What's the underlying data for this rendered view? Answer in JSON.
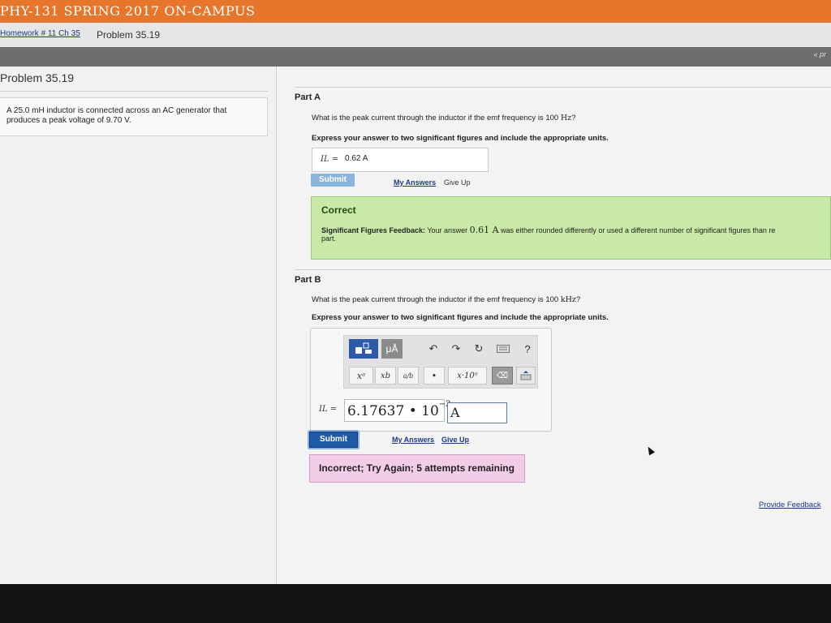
{
  "header": {
    "course_title": "PHY-131 SPRING 2017 ON-CAMPUS"
  },
  "breadcrumb": {
    "link": "Homework # 11 Ch 35",
    "current": "Problem 35.19"
  },
  "nav": {
    "prev": "« pr"
  },
  "problem": {
    "title": "Problem 35.19",
    "statement_line1": "A 25.0 mH inductor is connected across an AC generator that",
    "statement_line2": "produces a peak voltage of 9.70 V."
  },
  "part_a": {
    "title": "Part A",
    "question_text": "What is the peak current through the inductor if the emf frequency is 100 ",
    "question_unit": "Hz",
    "question_end": "?",
    "instruction": "Express your answer to two significant figures and include the appropriate units.",
    "answer_label": "IL =",
    "answer_value": "0.62 A",
    "submit_label": "Submit",
    "my_answers": "My Answers",
    "give_up": "Give Up",
    "feedback_title": "Correct",
    "feedback_bold": "Significant Figures Feedback:",
    "feedback_pre": " Your answer ",
    "feedback_value": "0.61 A",
    "feedback_post": " was either rounded differently or used a different number of significant figures than re",
    "feedback_line2": "part."
  },
  "part_b": {
    "title": "Part B",
    "question_text": "What is the peak current through the inductor if the emf frequency is 100 ",
    "question_unit": "kHz",
    "question_end": "?",
    "instruction": "Express your answer to two significant figures and include the appropriate units.",
    "toolbar": {
      "units_label": "μÅ",
      "superscript": "xᵃ",
      "subscript": "xb",
      "fraction": "a/b",
      "dot": "•",
      "sci_notation": "x·10ⁿ",
      "help": "?"
    },
    "answer_label": "IL =",
    "answer_mantissa": "6.17637 • 10",
    "answer_exponent": "−3",
    "answer_unit": "A",
    "submit_label": "Submit",
    "my_answers": "My Answers",
    "give_up": "Give Up",
    "result": "Incorrect; Try Again; 5 attempts remaining"
  },
  "footer": {
    "provide_feedback": "Provide Feedback"
  },
  "colors": {
    "accent": "#e8762a",
    "correct_bg": "#c8eaa6",
    "incorrect_bg": "#f1cde7",
    "submit_blue": "#1f5aa6"
  }
}
